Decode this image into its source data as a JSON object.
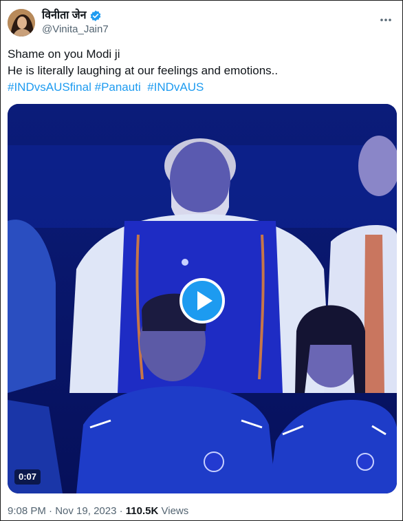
{
  "author": {
    "display_name": "विनीता जेन",
    "handle": "@Vinita_Jain7",
    "verified_icon": "verified-badge-icon",
    "avatar_icon": "profile-avatar"
  },
  "tweet": {
    "line1": "Shame on you Modi ji",
    "line2": "He is literally laughing at our feelings and emotions..",
    "hashtags": [
      "#INDvsAUSfinal",
      "#Panauti",
      "#INDvAUS"
    ]
  },
  "media": {
    "type": "video",
    "duration": "0:07",
    "play_icon": "play-icon"
  },
  "footer": {
    "time": "9:08 PM",
    "separator": "·",
    "date": "Nov 19, 2023",
    "views_count": "110.5K",
    "views_label": "Views"
  },
  "colors": {
    "link": "#1d9bf0",
    "secondary_text": "#536471",
    "verified": "#1d9bf0"
  }
}
